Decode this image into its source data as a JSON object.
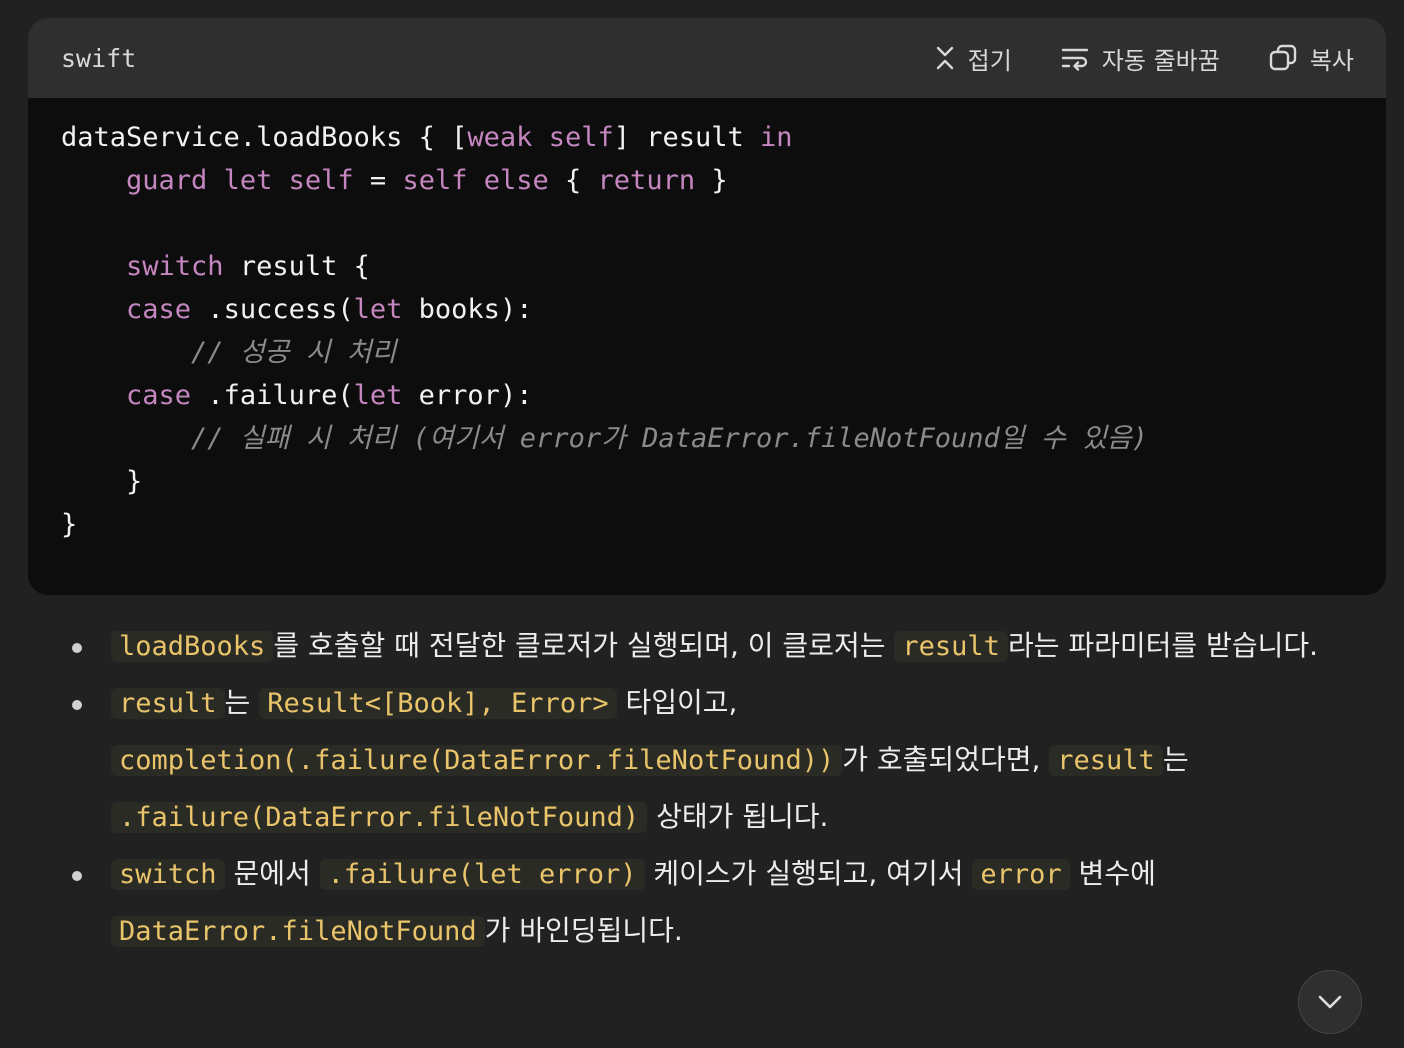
{
  "code_block": {
    "language": "swift",
    "actions": {
      "collapse": "접기",
      "wrap": "자동 줄바꿈",
      "copy": "복사"
    },
    "lines": {
      "l1_a": "dataService.loadBooks { [",
      "l1_kw1": "weak",
      "l1_sp": " ",
      "l1_kw2": "self",
      "l1_b": "] result ",
      "l1_kw3": "in",
      "l2_indent": "    ",
      "l2_kw1": "guard",
      "l2_sp1": " ",
      "l2_kw2": "let",
      "l2_sp2": " ",
      "l2_kw3": "self",
      "l2_eq": " = ",
      "l2_kw4": "self",
      "l2_sp3": " ",
      "l2_kw5": "else",
      "l2_br": " { ",
      "l2_kw6": "return",
      "l2_end": " }",
      "l4_kw": "switch",
      "l4_rest": " result {",
      "l5_kw": "case",
      "l5_a": " .success(",
      "l5_kw2": "let",
      "l5_b": " books):",
      "l6_comment": "// 성공 시 처리",
      "l7_kw": "case",
      "l7_a": " .failure(",
      "l7_kw2": "let",
      "l7_b": " error):",
      "l8_comment": "// 실패 시 처리 (여기서 error가 DataError.fileNotFound일 수 있음)",
      "l9": "}",
      "l10": "}"
    }
  },
  "bullets": {
    "b1": {
      "code1": "loadBooks",
      "text1": "를 호출할 때 전달한 클로저가 실행되며, 이 클로저는 ",
      "code2": "result",
      "text2": "라는 파라미터를 받습니다."
    },
    "b2": {
      "code1": "result",
      "text1": "는 ",
      "code2": "Result<[Book], Error>",
      "text2": " 타입이고, ",
      "code3": "completion(.failure(DataError.fileNotFound))",
      "text3": "가 호출되었다면, ",
      "code4": "result",
      "text4": "는 ",
      "code5": ".failure(DataError.fileNotFound)",
      "text5": " 상태가 됩니다."
    },
    "b3": {
      "code1": "switch",
      "text1": " 문에서 ",
      "code2": ".failure(let error)",
      "text2": " 케이스가 실행되고, 여기서 ",
      "code3": "error",
      "text3": " 변수에 ",
      "code4": "DataError.fileNotFound",
      "text4": "가 바인딩됩니다."
    }
  },
  "scroll_button": {
    "icon": "chevron-down-icon"
  }
}
